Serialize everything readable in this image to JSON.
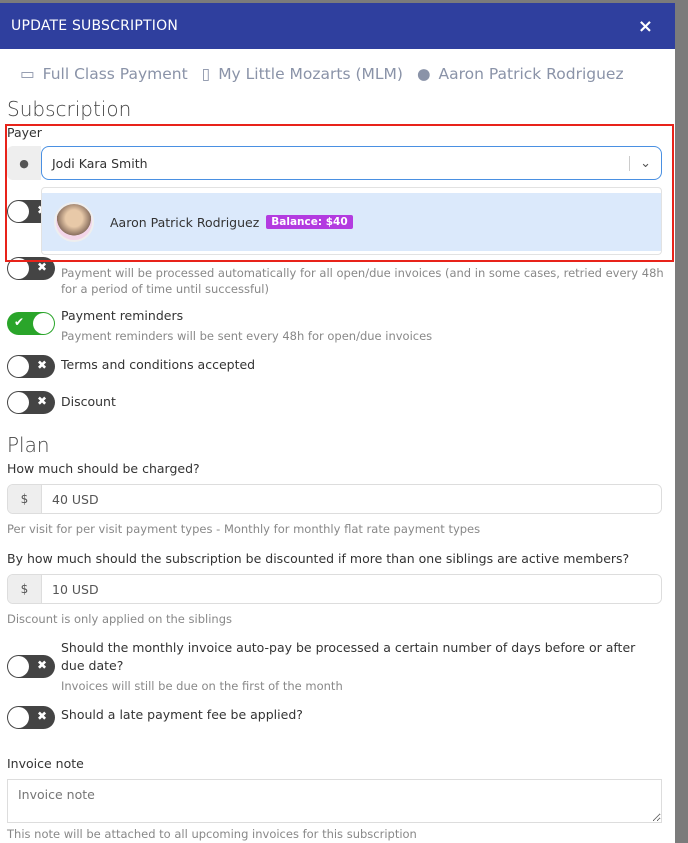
{
  "modal": {
    "title": "UPDATE SUBSCRIPTION",
    "close": "×"
  },
  "meta": [
    {
      "icon": "credit-card-icon",
      "label": "Full Class Payment"
    },
    {
      "icon": "clipboard-icon",
      "label": "My Little Mozarts (MLM)"
    },
    {
      "icon": "user-icon",
      "label": "Aaron Patrick Rodriguez"
    }
  ],
  "subscription": {
    "heading": "Subscription",
    "payer_label": "Payer",
    "payer_value": "Jodi Kara Smith",
    "dropdown": [
      {
        "name": "Aaron Patrick Rodriguez",
        "badge": "Balance: $40"
      }
    ],
    "autopay_help": "Payment will be processed automatically for all open/due invoices (and in some cases, retried every 48h for a period of time until successful)",
    "reminders_label": "Payment reminders",
    "reminders_help": "Payment reminders will be sent every 48h for open/due invoices",
    "reminders_on": true,
    "terms_label": "Terms and conditions accepted",
    "discount_label": "Discount"
  },
  "plan": {
    "heading": "Plan",
    "charge_label": "How much should be charged?",
    "charge_value": "40 USD",
    "currency": "$",
    "charge_help": "Per visit for per visit payment types - Monthly for monthly flat rate payment types",
    "sibling_label": "By how much should the subscription be discounted if more than one siblings are active members?",
    "sibling_value": "10 USD",
    "sibling_help": "Discount is only applied on the siblings",
    "offset_label": "Should the monthly invoice auto-pay be processed a certain number of days before or after due date?",
    "offset_help": "Invoices will still be due on the first of the month",
    "late_label": "Should a late payment fee be applied?",
    "note_label": "Invoice note",
    "note_placeholder": "Invoice note",
    "note_help": "This note will be attached to all upcoming invoices for this subscription"
  },
  "colors": {
    "header": "#2f3f9e",
    "highlight": "#e8231a",
    "badge": "#b33be0",
    "toggle_on": "#2aa52a"
  }
}
